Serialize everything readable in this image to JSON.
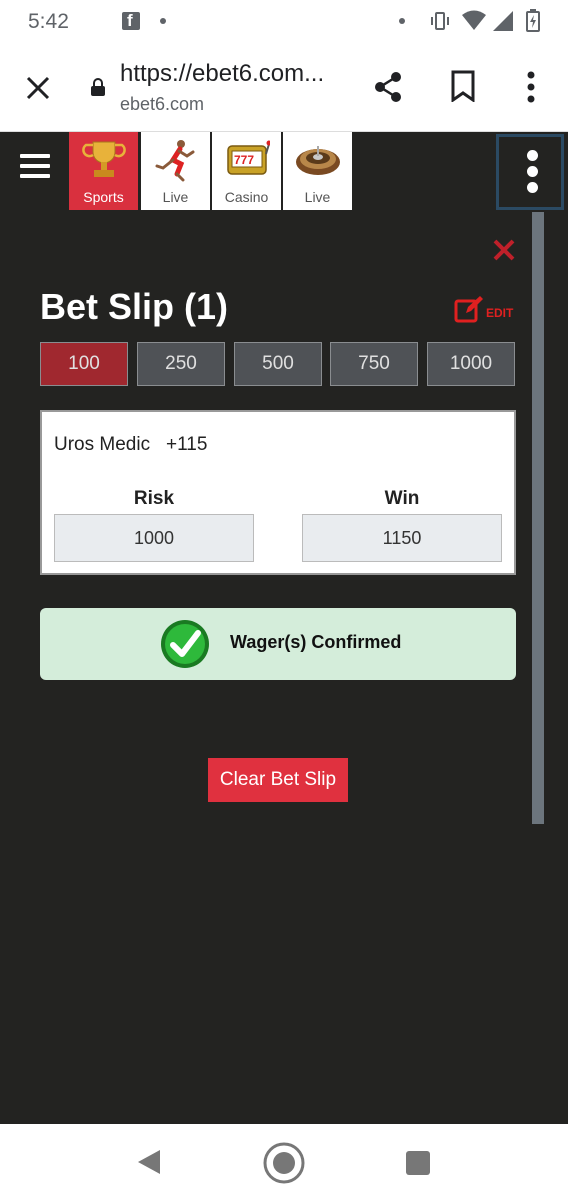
{
  "status_bar": {
    "time": "5:42",
    "icons": [
      "facebook-icon",
      "notification-dot-icon",
      "vibrate-icon",
      "wifi-icon",
      "signal-icon",
      "battery-icon"
    ]
  },
  "browser": {
    "url_title": "https://ebet6.com...",
    "url_domain": "ebet6.com",
    "icons": [
      "close-icon",
      "lock-icon",
      "share-icon",
      "bookmark-icon",
      "overflow-menu-icon"
    ]
  },
  "nav": {
    "tabs": [
      {
        "label": "Sports",
        "icon": "trophy-icon",
        "active": true
      },
      {
        "label": "Live",
        "icon": "runner-icon",
        "active": false
      },
      {
        "label": "Casino",
        "icon": "slot-machine-icon",
        "active": false
      },
      {
        "label": "Live",
        "icon": "roulette-icon",
        "active": false
      }
    ]
  },
  "betslip": {
    "title": "Bet Slip (1)",
    "edit_label": "EDIT",
    "amounts": [
      "100",
      "250",
      "500",
      "750",
      "1000"
    ],
    "selected_amount": "100",
    "selection": "Uros Medic",
    "odds": "+115",
    "risk_label": "Risk",
    "win_label": "Win",
    "risk_value": "1000",
    "win_value": "1150",
    "confirmation": "Wager(s) Confirmed",
    "clear_label": "Clear Bet Slip"
  },
  "colors": {
    "accent_red": "#d9303e",
    "site_bg": "#232321",
    "confirm_bg": "#d4edda"
  }
}
